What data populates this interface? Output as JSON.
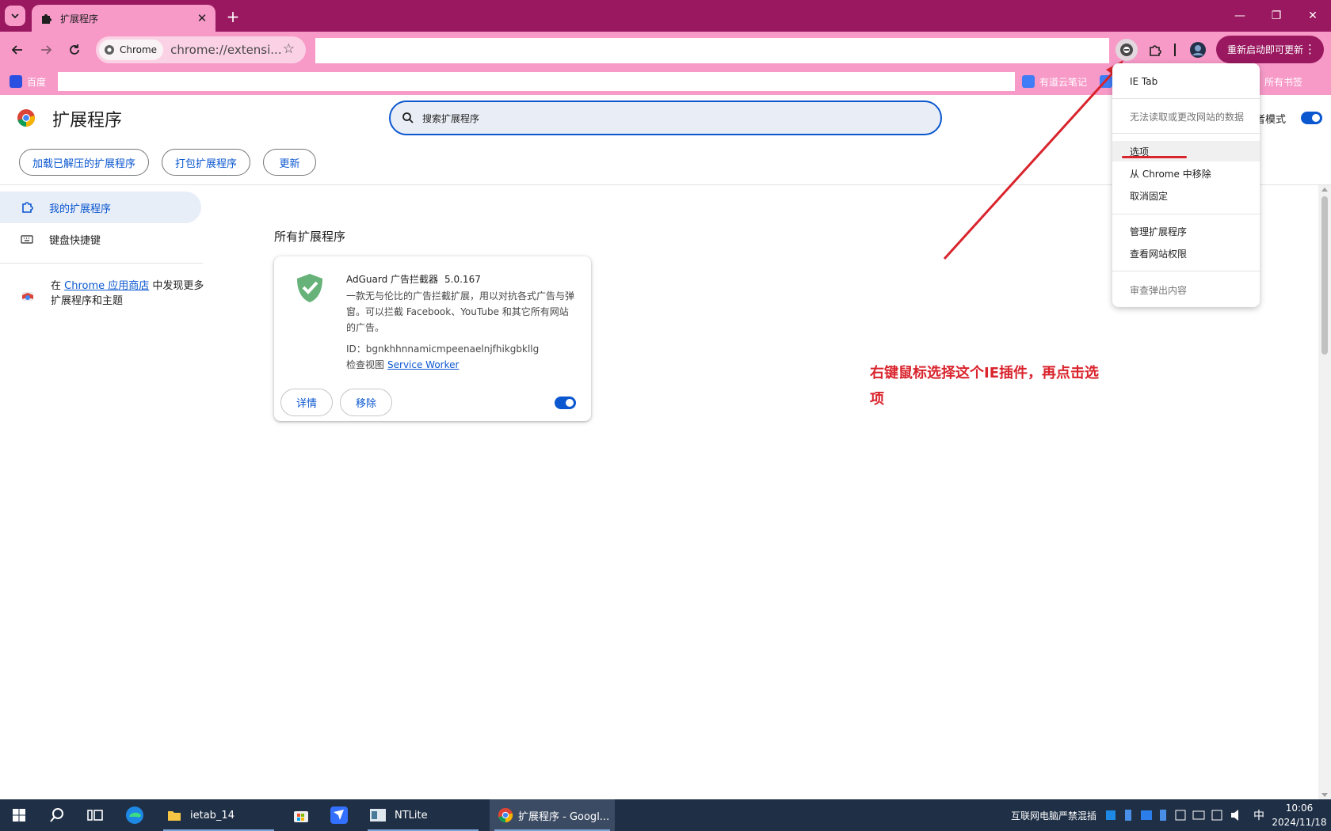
{
  "tab": {
    "title": "扩展程序",
    "close": "✕",
    "new_tab": "+"
  },
  "window_controls": {
    "minimize": "—",
    "restore": "❐",
    "close": "✕"
  },
  "omnibox": {
    "chip_label": "Chrome",
    "url": "chrome://extensi...",
    "bookmark_star": "☆"
  },
  "toolbar": {
    "relaunch_label": "重新启动即可更新",
    "menu": "⋮"
  },
  "bookmarks": {
    "baidu": "百度",
    "youdao": "有道云笔记",
    "all_bookmarks": "所有书签"
  },
  "header": {
    "title": "扩展程序",
    "search_placeholder": "搜索扩展程序",
    "dev_mode_label": "者模式",
    "buttons": {
      "load_unpacked": "加载已解压的扩展程序",
      "pack": "打包扩展程序",
      "update": "更新"
    }
  },
  "sidebar": {
    "items": [
      {
        "label": "我的扩展程序"
      },
      {
        "label": "键盘快捷键"
      }
    ],
    "store_prefix": "在 ",
    "store_link": "Chrome 应用商店",
    "store_suffix": " 中发现更多扩展程序和主题"
  },
  "main": {
    "section_title": "所有扩展程序",
    "extension": {
      "name": "AdGuard 广告拦截器",
      "version": "5.0.167",
      "description": "一款无与伦比的广告拦截扩展，用以对抗各式广告与弹窗。可以拦截 Facebook、YouTube 和其它所有网站的广告。",
      "id_label": "ID：bgnkhhnnamicmpeenaelnjfhikgbkllg",
      "inspect_label": "检查视图",
      "service_worker": "Service Worker",
      "details_button": "详情",
      "remove_button": "移除",
      "enabled": true
    }
  },
  "context_menu": {
    "title": "IE Tab",
    "cannot_read": "无法读取或更改网站的数据",
    "options": "选项",
    "remove_from_chrome": "从 Chrome 中移除",
    "unpin": "取消固定",
    "manage_extensions": "管理扩展程序",
    "view_site_permissions": "查看网站权限",
    "inspect_popup": "审查弹出内容"
  },
  "annotation": {
    "text": "右键鼠标选择这个IE插件，再点击选项"
  },
  "taskbar": {
    "apps": [
      {
        "label": "ietab_14"
      },
      {
        "label": "NTLite"
      },
      {
        "label": "扩展程序 - Googl..."
      }
    ],
    "tray_notice": "互联网电脑严禁混插",
    "ime": "中",
    "time": "10:06",
    "date": "2024/11/18"
  },
  "colors": {
    "tabstrip": "#99185f",
    "toolbar": "#f79ac8",
    "accent": "#0b57d0",
    "annotation": "#d9242d",
    "taskbar": "#1f2f46"
  }
}
